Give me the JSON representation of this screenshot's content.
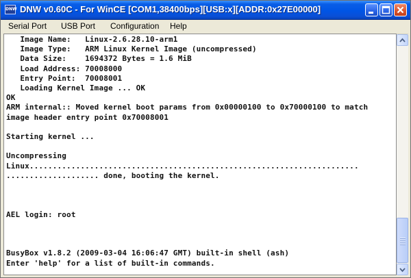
{
  "window": {
    "title": "DNW v0.60C - For WinCE    [COM1,38400bps][USB:x][ADDR:0x27E00000]",
    "icon_label": "DNW"
  },
  "title_buttons": {
    "minimize_icon": "minimize-icon",
    "maximize_icon": "maximize-icon",
    "close_icon": "close-icon"
  },
  "menu": {
    "items": [
      {
        "label": "Serial Port"
      },
      {
        "label": "USB Port"
      },
      {
        "label": "Configuration"
      },
      {
        "label": "Help"
      }
    ]
  },
  "terminal": {
    "lines": [
      "   Image Name:   Linux-2.6.28.10-arm1",
      "   Image Type:   ARM Linux Kernel Image (uncompressed)",
      "   Data Size:    1694372 Bytes = 1.6 MiB",
      "   Load Address: 70008000",
      "   Entry Point:  70008001",
      "   Loading Kernel Image ... OK",
      "OK",
      "ARM internal:: Moved kernel boot params from 0x00000100 to 0x70000100 to match",
      "image header entry point 0x70008001",
      "",
      "Starting kernel ...",
      "",
      "Uncompressing",
      "Linux.......................................................................",
      ".................... done, booting the kernel.",
      "",
      "",
      "",
      "AEL login: root",
      "",
      "",
      "",
      "BusyBox v1.8.2 (2009-03-04 16:06:47 GMT) built-in shell (ash)",
      "Enter 'help' for a list of built-in commands.",
      "",
      "#"
    ]
  },
  "scrollbar": {
    "up_icon": "scroll-up-arrow-icon",
    "down_icon": "scroll-down-arrow-icon",
    "position": 0.93
  },
  "colors": {
    "titlebar": "#0055e5",
    "terminal_bg": "#ffffff",
    "terminal_text": "#101010"
  }
}
